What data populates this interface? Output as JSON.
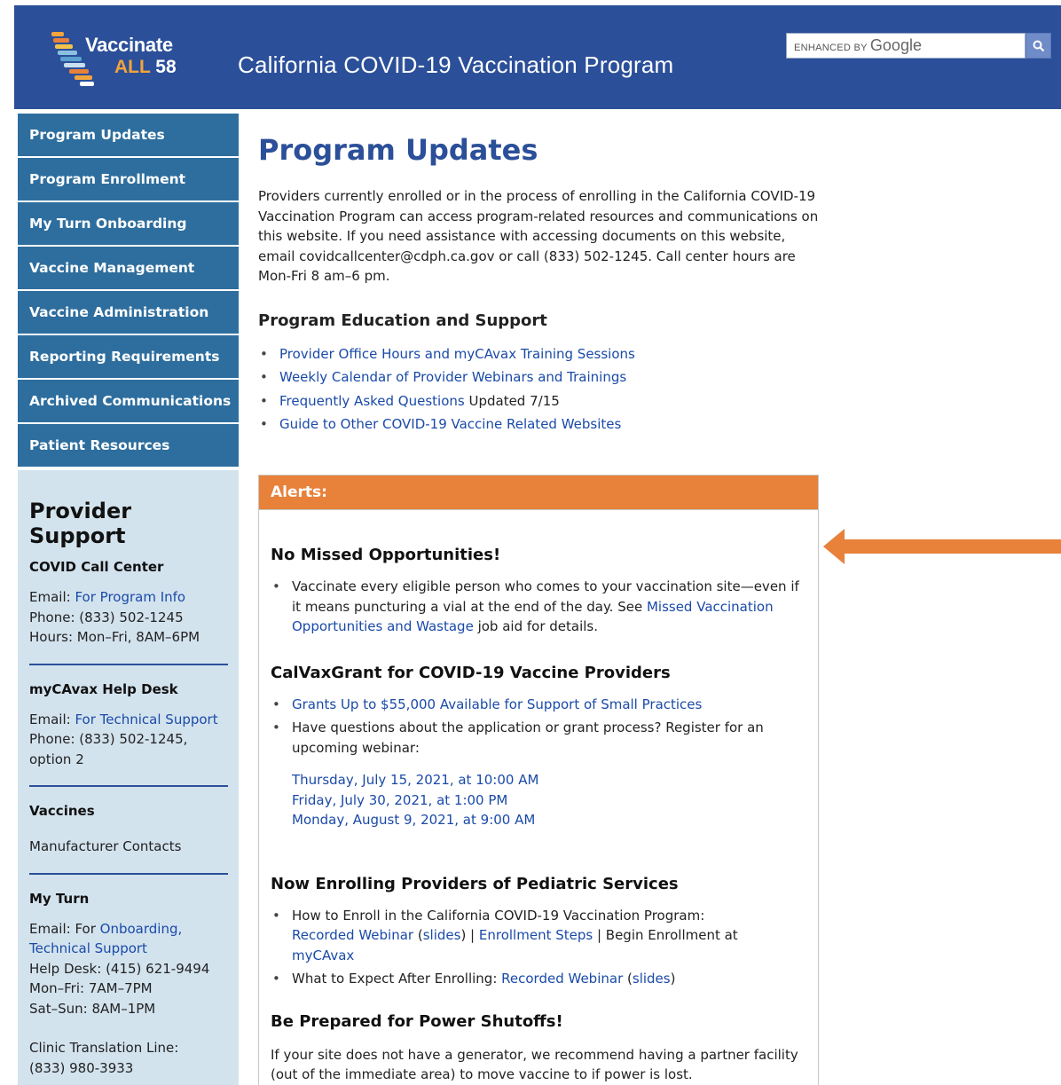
{
  "header": {
    "logo_line1": "Vaccinate",
    "logo_all": "ALL",
    "logo_58": " 58",
    "site_title": "California COVID-19 Vaccination Program",
    "search_brand_prefix": "ENHANCED BY ",
    "search_brand_google": "Google",
    "search_icon": "search-icon"
  },
  "nav": {
    "items": [
      {
        "label": "Program Updates"
      },
      {
        "label": "Program Enrollment"
      },
      {
        "label": "My Turn Onboarding"
      },
      {
        "label": "Vaccine Management"
      },
      {
        "label": "Vaccine Administration"
      },
      {
        "label": "Reporting Requirements"
      },
      {
        "label": "Archived Communications"
      },
      {
        "label": "Patient Resources"
      }
    ]
  },
  "support": {
    "title": "Provider Support",
    "call_center": {
      "heading": "COVID Call Center",
      "email_prefix": "Email: ",
      "email_link": "For Program Info",
      "phone": "Phone: (833) 502-1245",
      "hours": "Hours: Mon–Fri, 8AM–6PM"
    },
    "help_desk": {
      "heading": "myCAvax Help Desk",
      "email_prefix": "Email: ",
      "email_link": "For Technical Support",
      "phone": "Phone: (833) 502-1245,",
      "option": "option 2"
    },
    "vaccines": {
      "heading": "Vaccines",
      "link": "Manufacturer Contacts"
    },
    "my_turn": {
      "heading": "My Turn",
      "email_prefix": "Email: For ",
      "email_link1": "Onboarding,",
      "email_link2": "Technical Support",
      "help_desk": "Help Desk: (415) 621-9494",
      "weekday": "Mon–Fri: 7AM–7PM",
      "weekend": "Sat–Sun: 8AM–1PM"
    },
    "translation": {
      "label": "Clinic Translation Line:",
      "phone": "(833) 980-3933"
    }
  },
  "main": {
    "title": "Program Updates",
    "intro": "Providers currently enrolled or in the process of enrolling in the California COVID-19 Vaccination Program can access program-related resources and communications on this website. If you need assistance with accessing documents on this website, email covidcallcenter@cdph.ca.gov or call (833) 502-1245. Call center hours are Mon-Fri 8 am–6 pm.",
    "edu_heading": "Program Education and Support",
    "edu_links": [
      {
        "label": "Provider Office Hours and myCAvax Training Sessions"
      },
      {
        "label": "Weekly Calendar of Provider Webinars and Trainings"
      },
      {
        "label": "Frequently Asked Questions",
        "suffix": " Updated 7/15"
      },
      {
        "label": "Guide to Other COVID-19 Vaccine Related Websites"
      }
    ]
  },
  "alerts": {
    "bar_label": "Alerts:",
    "missed": {
      "heading": "No Missed Opportunities!",
      "text1": "Vaccinate every eligible person who comes to your vaccination site—even if it means puncturing a vial at the end of the day. See ",
      "link": "Missed Vaccination Opportunities and Wastage",
      "text2": " job aid for details."
    },
    "grant": {
      "heading": "CalVaxGrant for COVID-19 Vaccine Providers",
      "link": "Grants Up to $55,000 Available for Support of Small Practices",
      "question": "Have questions about the application or grant process? Register for an upcoming webinar:",
      "dates": [
        "Thursday, July 15, 2021, at 10:00 AM",
        "Friday, July 30, 2021, at 1:00 PM",
        "Monday, August 9, 2021, at 9:00 AM"
      ]
    },
    "pediatric": {
      "heading": "Now Enrolling Providers of Pediatric Services",
      "item1_text": "How to Enroll in the California COVID-19 Vaccination Program:",
      "item1_webinar": "Recorded Webinar",
      "item1_slides": "slides",
      "item1_steps": "Enrollment Steps",
      "item1_begin": " | Begin Enrollment at ",
      "item1_mycavax": "myCAvax",
      "item2_text": "What to Expect After Enrolling: ",
      "item2_webinar": "Recorded Webinar",
      "item2_slides": "slides"
    },
    "power": {
      "heading": "Be Prepared for Power Shutoffs!",
      "text": "If your site does not have a generator, we recommend having a partner facility (out of the immediate area) to move vaccine to if power is lost."
    }
  },
  "colors": {
    "header_blue": "#2b4f99",
    "nav_blue": "#2e6e9e",
    "support_bg": "#d3e3ee",
    "alert_orange": "#e8813a",
    "link_blue": "#1a4aa8"
  }
}
